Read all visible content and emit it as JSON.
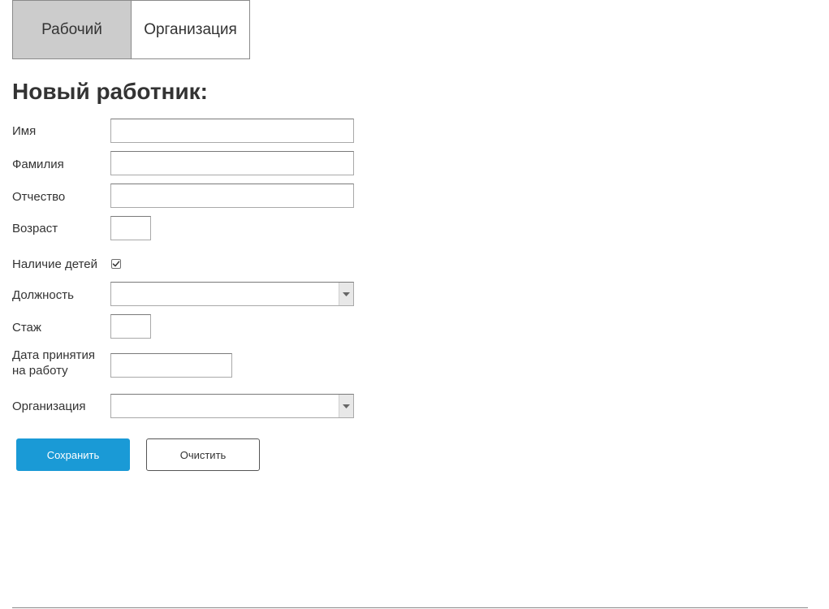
{
  "tabs": [
    {
      "label": "Рабочий",
      "active": true
    },
    {
      "label": "Организация",
      "active": false
    }
  ],
  "form": {
    "title": "Новый работник:",
    "first_name": {
      "label": "Имя",
      "value": ""
    },
    "last_name": {
      "label": "Фамилия",
      "value": ""
    },
    "patronymic": {
      "label": "Отчество",
      "value": ""
    },
    "age": {
      "label": "Возраст",
      "value": ""
    },
    "has_children": {
      "label": "Наличие детей",
      "checked": true
    },
    "position": {
      "label": "Должность",
      "selected": ""
    },
    "experience": {
      "label": "Стаж",
      "value": ""
    },
    "hire_date": {
      "label_line1": "Дата принятия",
      "label_line2": "на работу",
      "value": ""
    },
    "organization": {
      "label": "Организация",
      "selected": ""
    }
  },
  "buttons": {
    "save_label": "Сохранить",
    "clear_label": "Очистить"
  },
  "colors": {
    "primary_button": "#1a9ad6",
    "active_tab": "#cccccc"
  },
  "icons": {
    "checkbox_check": "check-icon",
    "select_arrow": "chevron-down-icon"
  }
}
